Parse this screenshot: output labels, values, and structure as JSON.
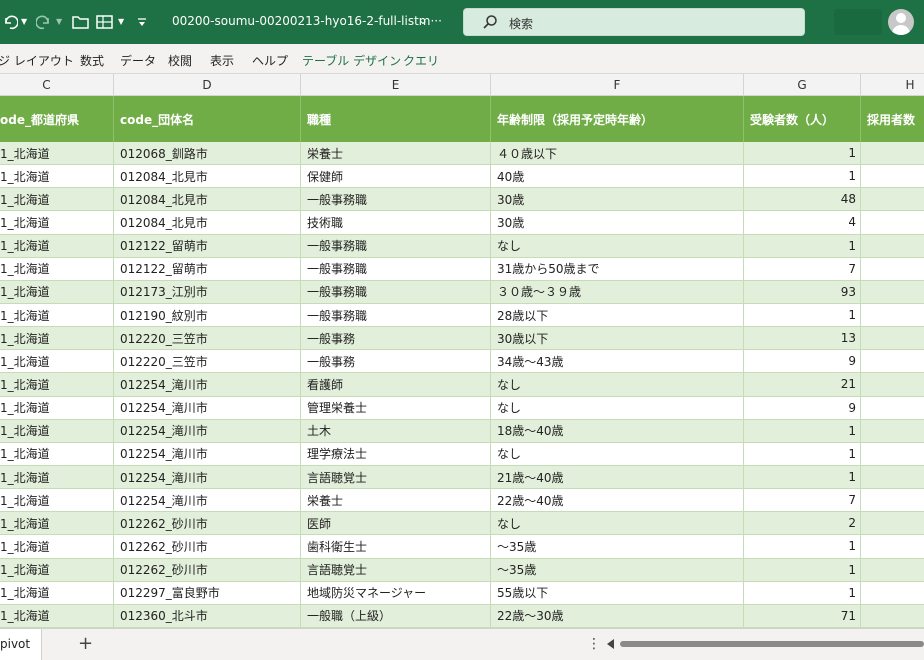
{
  "titlebar": {
    "filename": "00200-soumu-00200213-hyo16-2-full-listm···",
    "search_placeholder": "検索"
  },
  "ribbon": {
    "tabs": [
      {
        "label": "ジ レイアウト",
        "contextual": false
      },
      {
        "label": "数式",
        "contextual": false
      },
      {
        "label": "データ",
        "contextual": false
      },
      {
        "label": "校閲",
        "contextual": false
      },
      {
        "label": "表示",
        "contextual": false
      },
      {
        "label": "ヘルプ",
        "contextual": false
      },
      {
        "label": "テーブル デザイン",
        "contextual": true
      },
      {
        "label": "クエリ",
        "contextual": true
      }
    ]
  },
  "columns": [
    "C",
    "D",
    "E",
    "F",
    "G",
    "H"
  ],
  "table": {
    "headers": [
      "ode_都道府県",
      "code_団体名",
      "職種",
      "年齢制限（採用予定時年齢）",
      "受験者数（人）",
      "採用者数"
    ],
    "rows": [
      [
        "1_北海道",
        "012068_釧路市",
        "栄養士",
        "４０歳以下",
        "1",
        ""
      ],
      [
        "1_北海道",
        "012084_北見市",
        "保健師",
        "40歳",
        "1",
        ""
      ],
      [
        "1_北海道",
        "012084_北見市",
        "一般事務職",
        "30歳",
        "48",
        ""
      ],
      [
        "1_北海道",
        "012084_北見市",
        "技術職",
        "30歳",
        "4",
        ""
      ],
      [
        "1_北海道",
        "012122_留萌市",
        "一般事務職",
        "なし",
        "1",
        ""
      ],
      [
        "1_北海道",
        "012122_留萌市",
        "一般事務職",
        "31歳から50歳まで",
        "7",
        ""
      ],
      [
        "1_北海道",
        "012173_江別市",
        "一般事務職",
        "３０歳～３９歳",
        "93",
        ""
      ],
      [
        "1_北海道",
        "012190_紋別市",
        "一般事務職",
        "28歳以下",
        "1",
        ""
      ],
      [
        "1_北海道",
        "012220_三笠市",
        "一般事務",
        "30歳以下",
        "13",
        ""
      ],
      [
        "1_北海道",
        "012220_三笠市",
        "一般事務",
        "34歳～43歳",
        "9",
        ""
      ],
      [
        "1_北海道",
        "012254_滝川市",
        "看護師",
        "なし",
        "21",
        ""
      ],
      [
        "1_北海道",
        "012254_滝川市",
        "管理栄養士",
        "なし",
        "9",
        ""
      ],
      [
        "1_北海道",
        "012254_滝川市",
        "土木",
        "18歳～40歳",
        "1",
        ""
      ],
      [
        "1_北海道",
        "012254_滝川市",
        "理学療法士",
        "なし",
        "1",
        ""
      ],
      [
        "1_北海道",
        "012254_滝川市",
        "言語聴覚士",
        "21歳～40歳",
        "1",
        ""
      ],
      [
        "1_北海道",
        "012254_滝川市",
        "栄養士",
        "22歳～40歳",
        "7",
        ""
      ],
      [
        "1_北海道",
        "012262_砂川市",
        "医師",
        "なし",
        "2",
        ""
      ],
      [
        "1_北海道",
        "012262_砂川市",
        "歯科衛生士",
        "～35歳",
        "1",
        ""
      ],
      [
        "1_北海道",
        "012262_砂川市",
        "言語聴覚士",
        "～35歳",
        "1",
        ""
      ],
      [
        "1_北海道",
        "012297_富良野市",
        "地域防災マネージャー",
        "55歳以下",
        "1",
        ""
      ],
      [
        "1_北海道",
        "012360_北斗市",
        "一般職（上級）",
        "22歳～30歳",
        "71",
        ""
      ]
    ]
  },
  "bottombar": {
    "sheet_tab": "pivot",
    "add_sheet": "+",
    "more": "⋮"
  },
  "colors": {
    "titlebar": "#1e7145",
    "table_header": "#70ad47",
    "band": "#e2efda"
  }
}
